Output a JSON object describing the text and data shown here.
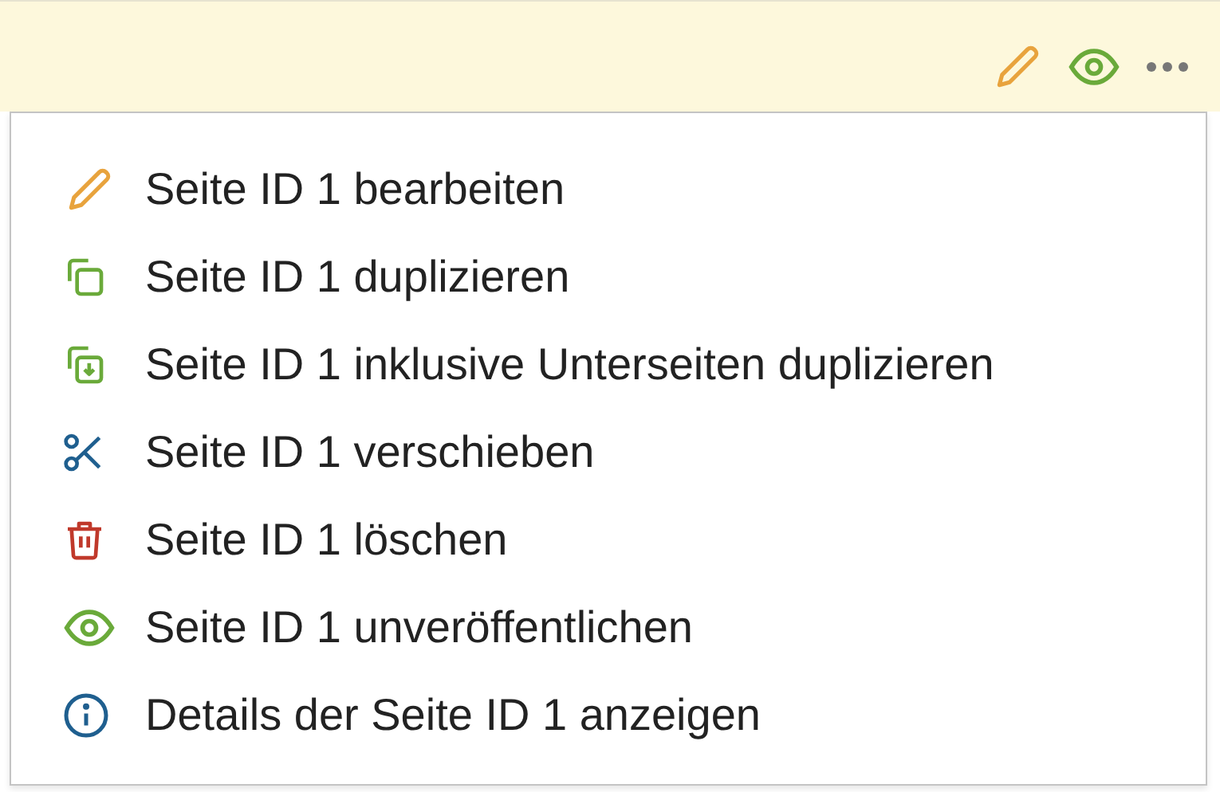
{
  "toolbar": {
    "actions": [
      {
        "kind": "edit"
      },
      {
        "kind": "view"
      },
      {
        "kind": "more"
      }
    ]
  },
  "menu": {
    "items": [
      {
        "kind": "edit",
        "label": "Seite ID 1 bearbeiten",
        "color": "#e8a33d"
      },
      {
        "kind": "copy",
        "label": "Seite ID 1 duplizieren",
        "color": "#6aaa3a"
      },
      {
        "kind": "copy-into",
        "label": "Seite ID 1 inklusive Unterseiten duplizieren",
        "color": "#6aaa3a"
      },
      {
        "kind": "cut",
        "label": "Seite ID 1 verschieben",
        "color": "#1f5f8f"
      },
      {
        "kind": "delete",
        "label": "Seite ID 1 löschen",
        "color": "#c0392b"
      },
      {
        "kind": "view",
        "label": "Seite ID 1 unveröffentlichen",
        "color": "#6aaa3a"
      },
      {
        "kind": "info",
        "label": "Details der Seite ID 1 anzeigen",
        "color": "#1f5f8f"
      }
    ]
  }
}
